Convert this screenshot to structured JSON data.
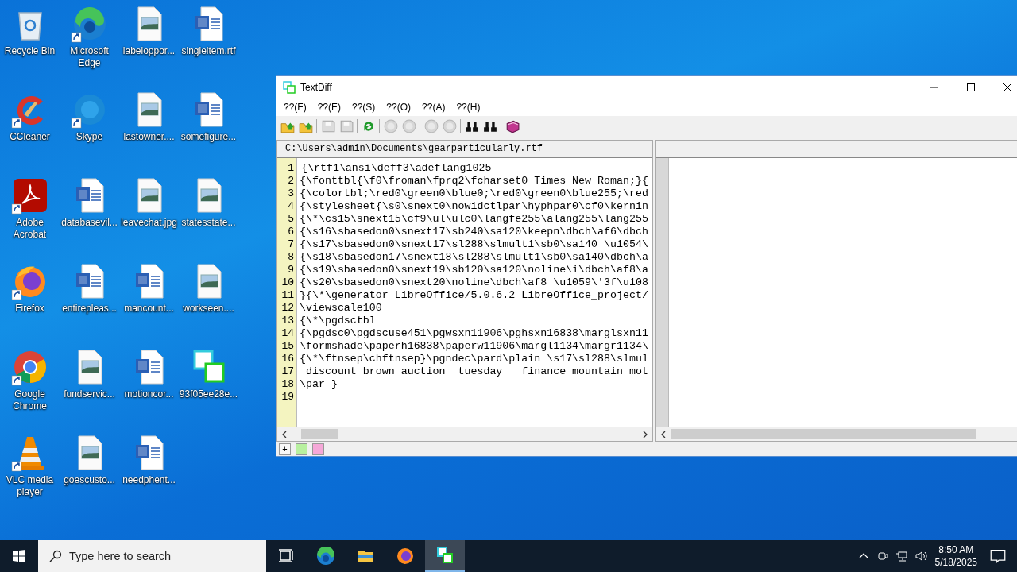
{
  "desktop_icons": [
    {
      "label": "Recycle Bin",
      "kind": "recycle",
      "shortcut": false
    },
    {
      "label": "CCleaner",
      "kind": "ccleaner",
      "shortcut": true
    },
    {
      "label": "Adobe Acrobat",
      "kind": "acrobat",
      "shortcut": true
    },
    {
      "label": "Firefox",
      "kind": "firefox",
      "shortcut": true
    },
    {
      "label": "Google Chrome",
      "kind": "chrome",
      "shortcut": true
    },
    {
      "label": "VLC media player",
      "kind": "vlc",
      "shortcut": true
    },
    {
      "label": "Microsoft Edge",
      "kind": "edge",
      "shortcut": true
    },
    {
      "label": "Skype",
      "kind": "skype",
      "shortcut": true
    },
    {
      "label": "databasevil...",
      "kind": "word",
      "shortcut": false
    },
    {
      "label": "entirepleas...",
      "kind": "word",
      "shortcut": false
    },
    {
      "label": "fundservic...",
      "kind": "image",
      "shortcut": false
    },
    {
      "label": "goescusto...",
      "kind": "image",
      "shortcut": false
    },
    {
      "label": "labeloppor...",
      "kind": "image",
      "shortcut": false
    },
    {
      "label": "lastowner....",
      "kind": "image",
      "shortcut": false
    },
    {
      "label": "leavechat.jpg",
      "kind": "image",
      "shortcut": false
    },
    {
      "label": "mancount...",
      "kind": "word",
      "shortcut": false
    },
    {
      "label": "motioncor...",
      "kind": "word",
      "shortcut": false
    },
    {
      "label": "needphent...",
      "kind": "word",
      "shortcut": false
    },
    {
      "label": "singleitem.rtf",
      "kind": "word",
      "shortcut": false
    },
    {
      "label": "somefigure...",
      "kind": "word",
      "shortcut": false
    },
    {
      "label": "statesstate...",
      "kind": "image",
      "shortcut": false
    },
    {
      "label": "workseen....",
      "kind": "image",
      "shortcut": false
    },
    {
      "label": "93f05ee28e...",
      "kind": "textdiff",
      "shortcut": false
    }
  ],
  "window": {
    "title": "TextDiff",
    "menu": [
      "??(F)",
      "??(E)",
      "??(S)",
      "??(O)",
      "??(A)",
      "??(H)"
    ],
    "toolbar": [
      {
        "kind": "open",
        "disabled": false
      },
      {
        "kind": "open",
        "disabled": false
      },
      {
        "kind": "separator"
      },
      {
        "kind": "save",
        "disabled": true
      },
      {
        "kind": "save",
        "disabled": true
      },
      {
        "kind": "separator"
      },
      {
        "kind": "refresh",
        "disabled": false
      },
      {
        "kind": "separator"
      },
      {
        "kind": "circle",
        "disabled": true
      },
      {
        "kind": "circle",
        "disabled": true
      },
      {
        "kind": "separator"
      },
      {
        "kind": "circle",
        "disabled": true
      },
      {
        "kind": "circle",
        "disabled": true
      },
      {
        "kind": "separator"
      },
      {
        "kind": "find",
        "disabled": false
      },
      {
        "kind": "find",
        "disabled": false
      },
      {
        "kind": "separator"
      },
      {
        "kind": "book",
        "disabled": false
      }
    ],
    "left_pane": {
      "path": "C:\\Users\\admin\\Documents\\gearparticularly.rtf",
      "lines": [
        {
          "number": "1",
          "text": "{\\rtf1\\ansi\\deff3\\adeflang1025"
        },
        {
          "number": "2",
          "text": "{\\fonttbl{\\f0\\froman\\fprq2\\fcharset0 Times New Roman;}{"
        },
        {
          "number": "3",
          "text": "{\\colortbl;\\red0\\green0\\blue0;\\red0\\green0\\blue255;\\red"
        },
        {
          "number": "4",
          "text": "{\\stylesheet{\\s0\\snext0\\nowidctlpar\\hyphpar0\\cf0\\kernin"
        },
        {
          "number": "5",
          "text": "{\\*\\cs15\\snext15\\cf9\\ul\\ulc0\\langfe255\\alang255\\lang255"
        },
        {
          "number": "6",
          "text": "{\\s16\\sbasedon0\\snext17\\sb240\\sa120\\keepn\\dbch\\af6\\dbch"
        },
        {
          "number": "7",
          "text": "{\\s17\\sbasedon0\\snext17\\sl288\\slmult1\\sb0\\sa140 \\u1054\\"
        },
        {
          "number": "8",
          "text": "{\\s18\\sbasedon17\\snext18\\sl288\\slmult1\\sb0\\sa140\\dbch\\a"
        },
        {
          "number": "9",
          "text": "{\\s19\\sbasedon0\\snext19\\sb120\\sa120\\noline\\i\\dbch\\af8\\a"
        },
        {
          "number": "10",
          "text": "{\\s20\\sbasedon0\\snext20\\noline\\dbch\\af8 \\u1059\\'3f\\u108"
        },
        {
          "number": "11",
          "text": "}{\\*\\generator LibreOffice/5.0.6.2 LibreOffice_project/"
        },
        {
          "number": "12",
          "text": "\\viewscale100"
        },
        {
          "number": "13",
          "text": "{\\*\\pgdsctbl"
        },
        {
          "number": "14",
          "text": "{\\pgdsc0\\pgdscuse451\\pgwsxn11906\\pghsxn16838\\marglsxn11"
        },
        {
          "number": "15",
          "text": "\\formshade\\paperh16838\\paperw11906\\margl1134\\margr1134\\"
        },
        {
          "number": "16",
          "text": "{\\*\\ftnsep\\chftnsep}\\pgndec\\pard\\plain \\s17\\sl288\\slmul"
        },
        {
          "number": "17",
          "text": " discount brown auction  tuesday   finance mountain mot"
        },
        {
          "number": "18",
          "text": "\\par }"
        },
        {
          "number": "19"
        }
      ]
    },
    "status_bar": {
      "add_label": "+",
      "legend": [
        {
          "color": "#b8f0a0"
        },
        {
          "color": "#f5a8d8"
        }
      ]
    }
  },
  "taskbar": {
    "search_placeholder": "Type here to search",
    "apps": [
      {
        "kind": "taskview",
        "selected": false
      },
      {
        "kind": "edge",
        "selected": false
      },
      {
        "kind": "explorer",
        "selected": false
      },
      {
        "kind": "firefox",
        "selected": false
      },
      {
        "kind": "textdiff",
        "selected": true
      }
    ],
    "time": "8:50 AM",
    "date": "5/18/2025"
  }
}
